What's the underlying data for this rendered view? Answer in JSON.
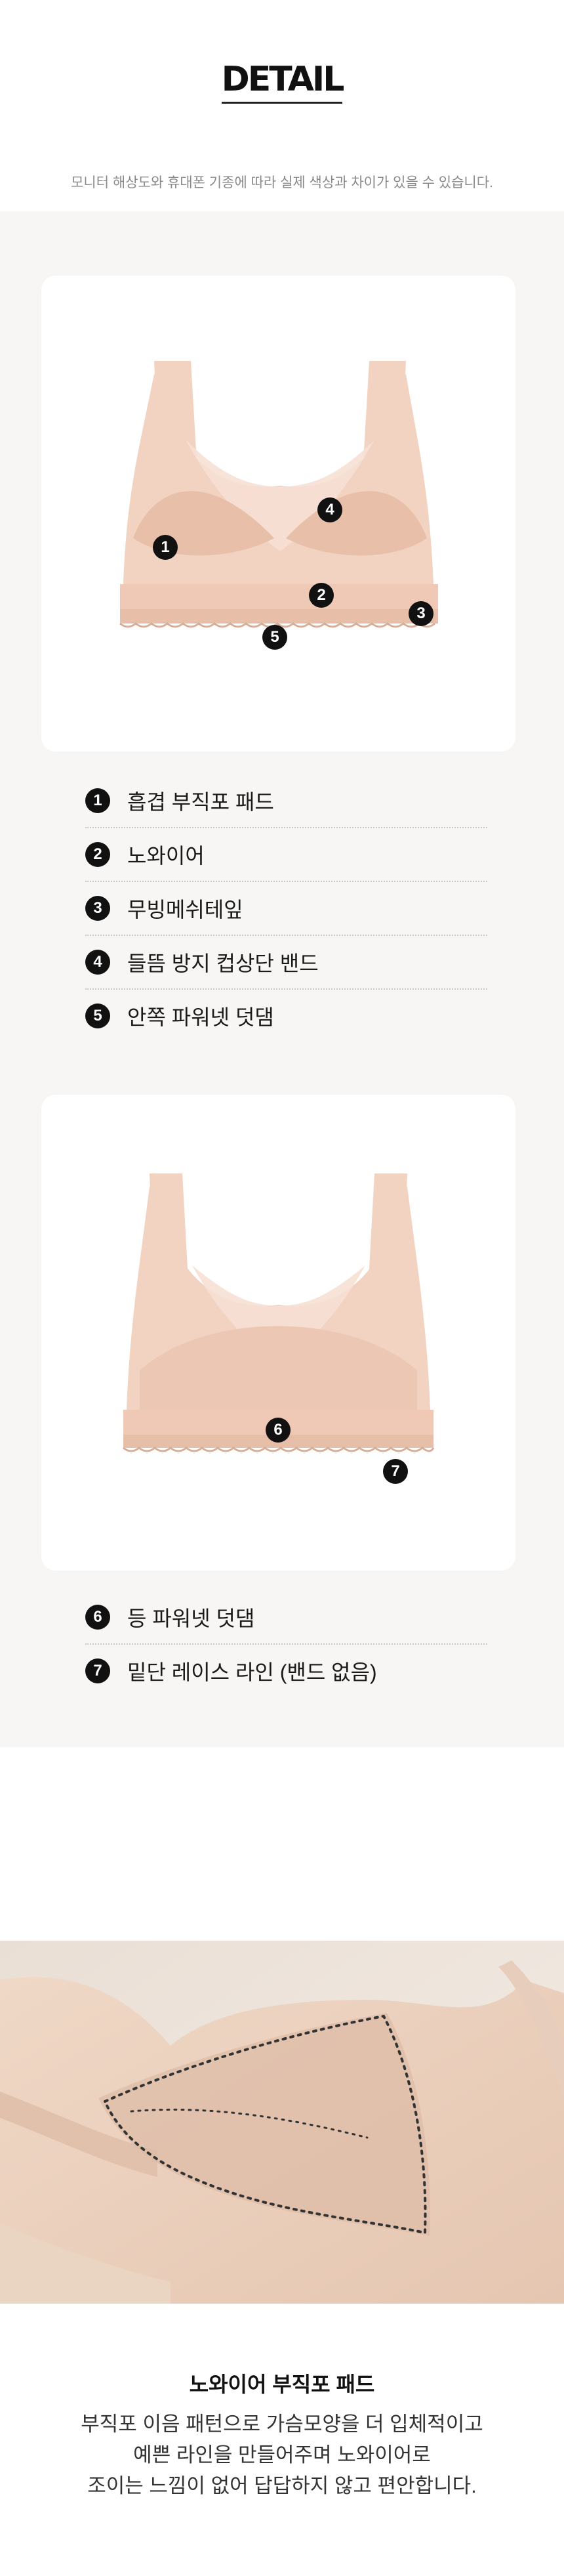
{
  "header": {
    "title": "DETAIL",
    "notice": "모니터 해상도와 휴대폰 기종에 따라 실제 색상과 차이가 있을 수 있습니다."
  },
  "front": {
    "markers": [
      "1",
      "2",
      "3",
      "4",
      "5"
    ],
    "items": [
      {
        "num": "1",
        "label": "흡겹 부직포 패드"
      },
      {
        "num": "2",
        "label": "노와이어"
      },
      {
        "num": "3",
        "label": "무빙메쉬테잎"
      },
      {
        "num": "4",
        "label": "들뜸 방지 컵상단 밴드"
      },
      {
        "num": "5",
        "label": "안쪽 파워넷 덧댐"
      }
    ]
  },
  "back": {
    "markers": [
      "6",
      "7"
    ],
    "items": [
      {
        "num": "6",
        "label": "등 파워넷 덧댐"
      },
      {
        "num": "7",
        "label": "밑단 레이스 라인 (밴드 없음)"
      }
    ]
  },
  "feature": {
    "title": "노와이어 부직포 패드",
    "lines": [
      "부직포 이음 패턴으로 가슴모양을 더 입체적이고",
      "예쁜 라인을 만들어주며 노와이어로",
      "조이는 느낌이 없어 답답하지 않고 편안합니다."
    ]
  },
  "colors": {
    "fabric": "#f2d3c2",
    "fabric_dark": "#e8bfa9",
    "section_bg": "#f7f6f4",
    "marker": "#111111"
  }
}
